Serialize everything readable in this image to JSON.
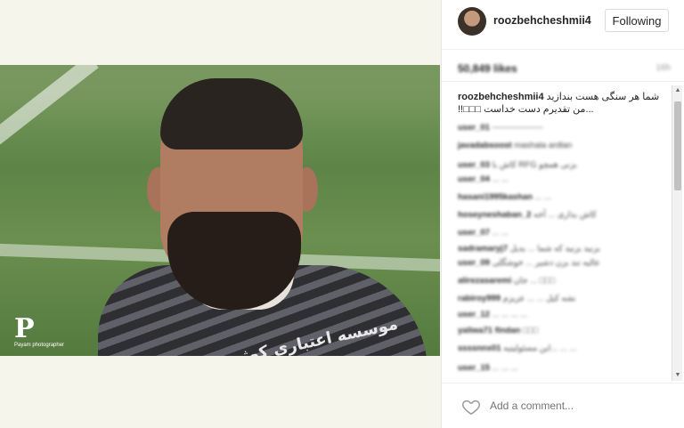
{
  "post": {
    "photo_alt": "",
    "sponsor_text": "موسسه اعتباری کوثر",
    "watermark": {
      "logo": "P",
      "sub": "Payam photographer"
    }
  },
  "header": {
    "username": "roozbehcheshmii4",
    "follow_label": "Following"
  },
  "stats": {
    "likes": "50,849 likes",
    "time": "16h"
  },
  "caption": {
    "username": "roozbehcheshmii4",
    "text_line1": "شما هر سنگی هست بندازید",
    "text_line2": "...من تقدیرم دست خداست □□□!!"
  },
  "comments": [
    {
      "user": "user_01",
      "text": "------------------"
    },
    {
      "user": "javadabsoost",
      "text": "mashala ardlan"
    },
    {
      "user": "user_03",
      "text": "کاش با RFG بزنی همچو"
    },
    {
      "user": "user_04",
      "text": "... ..."
    },
    {
      "user": "hasani1995kashan",
      "text": "... ..."
    },
    {
      "user": "hoseyneshaban_2",
      "text": "کاش بذاری ... آخه"
    },
    {
      "user": "user_07",
      "text": "... ..."
    },
    {
      "user": "sadramaryj7",
      "text": "بزنید بزنید که شما ... بدیل"
    },
    {
      "user": "user_09",
      "text": "عالیه تند بزن دشیر ... خوشگلی"
    },
    {
      "user": "alirezasaremi",
      "text": "جان ... □□□"
    },
    {
      "user": "rabiroy999",
      "text": "نشه کیل ... ... عزیزم"
    },
    {
      "user": "user_12",
      "text": "... ... ... ..."
    },
    {
      "user": "yaliwa71 findan",
      "text": "□□□"
    },
    {
      "user": "ssssnnx01",
      "text": "این مسئولیتیه... ... ..."
    },
    {
      "user": "user_15",
      "text": "... ... ..."
    }
  ],
  "footer": {
    "placeholder": "Add a comment..."
  },
  "colors": {
    "accent": "#262626",
    "background": "#f4f4ee",
    "panel": "#ffffff"
  }
}
